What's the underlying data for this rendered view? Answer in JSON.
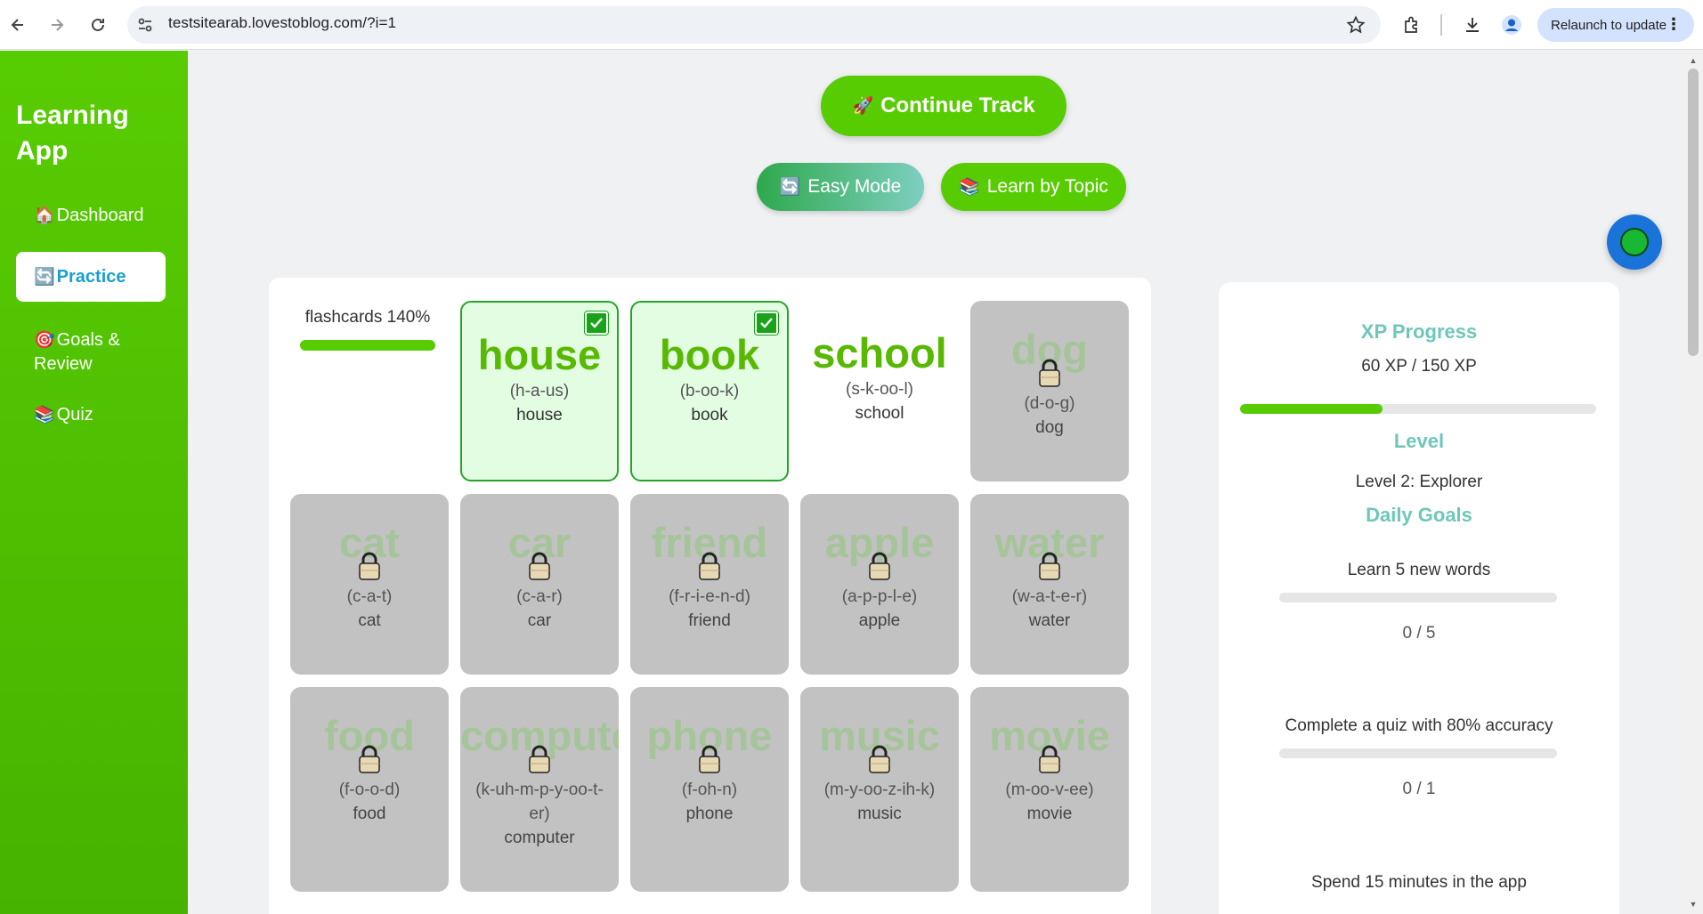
{
  "browser": {
    "url": "testsitearab.lovestoblog.com/?i=1",
    "relaunch_label": "Relaunch to update"
  },
  "sidebar": {
    "app_title": "Learning App",
    "items": [
      {
        "emoji": "🏠",
        "label": "Dashboard",
        "active": false
      },
      {
        "emoji": "🔄",
        "label": "Practice",
        "active": true
      },
      {
        "emoji": "🎯",
        "label": "Goals & Review",
        "active": false
      },
      {
        "emoji": "📚",
        "label": "Quiz",
        "active": false
      }
    ]
  },
  "actions": {
    "continue_emoji": "🚀",
    "continue_label": "Continue Track",
    "easy_emoji": "🔄",
    "easy_label": "Easy Mode",
    "topic_emoji": "📚",
    "topic_label": "Learn by Topic"
  },
  "flashcards": {
    "progress_label": "flashcards 140%",
    "progress_percent": 140,
    "cards": [
      {
        "word": "house",
        "phonetic": "(h-a-us)",
        "translation": "house",
        "state": "learned"
      },
      {
        "word": "book",
        "phonetic": "(b-oo-k)",
        "translation": "book",
        "state": "learned"
      },
      {
        "word": "school",
        "phonetic": "(s-k-oo-l)",
        "translation": "school",
        "state": "open"
      },
      {
        "word": "dog",
        "phonetic": "(d-o-g)",
        "translation": "dog",
        "state": "locked"
      },
      {
        "word": "cat",
        "phonetic": "(c-a-t)",
        "translation": "cat",
        "state": "locked"
      },
      {
        "word": "car",
        "phonetic": "(c-a-r)",
        "translation": "car",
        "state": "locked"
      },
      {
        "word": "friend",
        "phonetic": "(f-r-i-e-n-d)",
        "translation": "friend",
        "state": "locked"
      },
      {
        "word": "apple",
        "phonetic": "(a-p-p-l-e)",
        "translation": "apple",
        "state": "locked"
      },
      {
        "word": "water",
        "phonetic": "(w-a-t-e-r)",
        "translation": "water",
        "state": "locked"
      },
      {
        "word": "food",
        "phonetic": "(f-o-o-d)",
        "translation": "food",
        "state": "locked"
      },
      {
        "word": "computer",
        "phonetic": "(k-uh-m-p-y-oo-t-er)",
        "translation": "computer",
        "state": "locked"
      },
      {
        "word": "phone",
        "phonetic": "(f-oh-n)",
        "translation": "phone",
        "state": "locked"
      },
      {
        "word": "music",
        "phonetic": "(m-y-oo-z-ih-k)",
        "translation": "music",
        "state": "locked"
      },
      {
        "word": "movie",
        "phonetic": "(m-oo-v-ee)",
        "translation": "movie",
        "state": "locked"
      }
    ]
  },
  "stats": {
    "xp_heading": "XP Progress",
    "xp_text": "60 XP / 150 XP",
    "xp_fraction": 0.4,
    "level_heading": "Level",
    "level_text": "Level 2: Explorer",
    "goals_heading": "Daily Goals",
    "goals": [
      {
        "label": "Learn 5 new words",
        "count": "0 / 5",
        "fraction": 0
      },
      {
        "label": "Complete a quiz with 80% accuracy",
        "count": "0 / 1",
        "fraction": 0
      },
      {
        "label": "Spend 15 minutes in the app"
      }
    ]
  },
  "colors": {
    "brand_green": "#58cc02",
    "accent_teal": "#6ec7b8",
    "fab_blue": "#1a73d9"
  }
}
